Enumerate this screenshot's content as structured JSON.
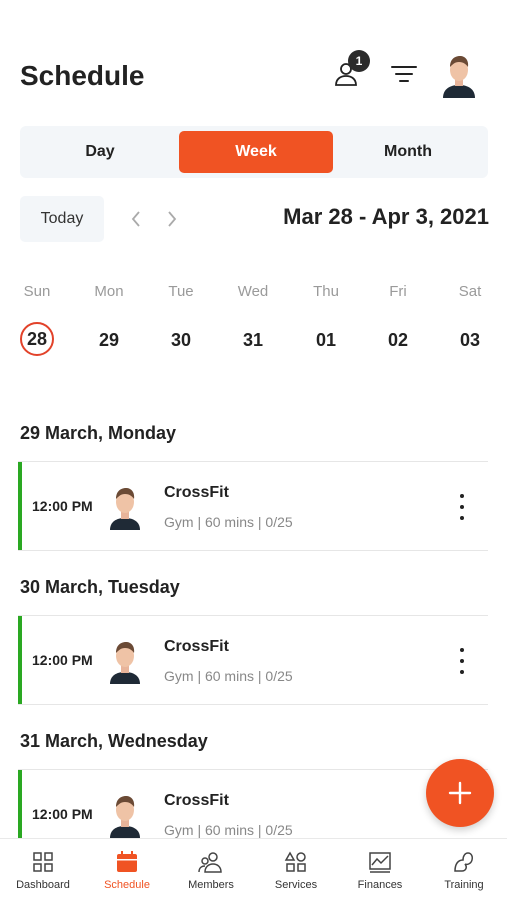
{
  "header": {
    "title": "Schedule",
    "notification_count": "1",
    "icons": {
      "user": "user-icon",
      "filter": "filter-icon",
      "avatar": "profile-avatar"
    }
  },
  "view_switcher": {
    "options": [
      "Day",
      "Week",
      "Month"
    ],
    "selected": "Week"
  },
  "date_nav": {
    "today_label": "Today",
    "range": "Mar 28 - Apr 3, 2021"
  },
  "week_days": [
    {
      "name": "Sun",
      "num": "28",
      "current": true
    },
    {
      "name": "Mon",
      "num": "29",
      "current": false
    },
    {
      "name": "Tue",
      "num": "30",
      "current": false
    },
    {
      "name": "Wed",
      "num": "31",
      "current": false
    },
    {
      "name": "Thu",
      "num": "01",
      "current": false
    },
    {
      "name": "Fri",
      "num": "02",
      "current": false
    },
    {
      "name": "Sat",
      "num": "03",
      "current": false
    }
  ],
  "sections": [
    {
      "title": "29 March, Monday",
      "events": [
        {
          "time": "12:00 PM",
          "name": "CrossFit",
          "meta": "Gym | 60 mins | 0/25"
        }
      ]
    },
    {
      "title": "30 March, Tuesday",
      "events": [
        {
          "time": "12:00 PM",
          "name": "CrossFit",
          "meta": "Gym | 60 mins | 0/25"
        }
      ]
    },
    {
      "title": "31 March, Wednesday",
      "events": [
        {
          "time": "12:00 PM",
          "name": "CrossFit",
          "meta": "Gym | 60 mins | 0/25"
        }
      ]
    }
  ],
  "fab": {
    "icon": "plus-icon"
  },
  "tabbar": {
    "items": [
      {
        "label": "Dashboard",
        "icon": "dashboard-icon",
        "active": false
      },
      {
        "label": "Schedule",
        "icon": "calendar-icon",
        "active": true
      },
      {
        "label": "Members",
        "icon": "members-icon",
        "active": false
      },
      {
        "label": "Services",
        "icon": "services-icon",
        "active": false
      },
      {
        "label": "Finances",
        "icon": "finances-icon",
        "active": false
      },
      {
        "label": "Training",
        "icon": "training-icon",
        "active": false
      }
    ]
  },
  "colors": {
    "accent": "#f05323",
    "event_accent": "#2aa822",
    "today_ring": "#e2422a"
  }
}
